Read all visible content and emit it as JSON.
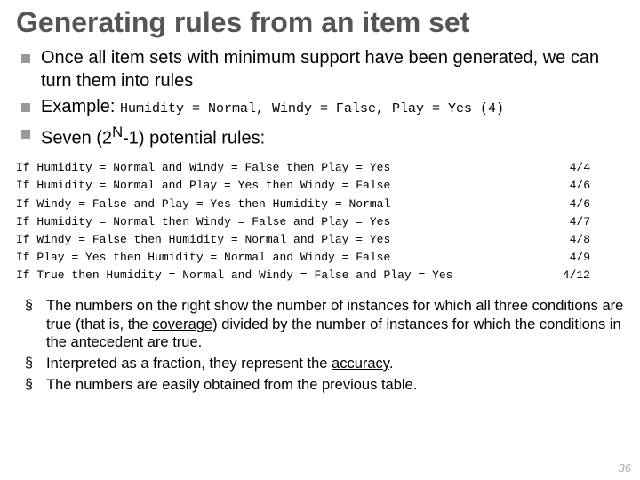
{
  "title": "Generating rules from an item set",
  "bullets": {
    "b1": "Once all item sets with minimum support have been generated, we can turn them into rules",
    "b2_prefix": "Example:",
    "b2_example": "Humidity = Normal, Windy = False, Play = Yes (4)",
    "b3_pre": "Seven (2",
    "b3_sup": "N",
    "b3_post": "-1) potential rules:"
  },
  "rules": [
    {
      "text": "If Humidity = Normal and Windy = False then Play = Yes",
      "ratio": "4/4"
    },
    {
      "text": "If Humidity = Normal and Play = Yes then Windy = False",
      "ratio": "4/6"
    },
    {
      "text": "If Windy = False and Play = Yes then Humidity = Normal",
      "ratio": "4/6"
    },
    {
      "text": "If Humidity = Normal then Windy = False and Play = Yes",
      "ratio": "4/7"
    },
    {
      "text": "If Windy = False then Humidity = Normal and Play = Yes",
      "ratio": "4/8"
    },
    {
      "text": "If Play = Yes then Humidity = Normal and Windy = False",
      "ratio": "4/9"
    },
    {
      "text": "If True then Humidity = Normal and Windy = False and Play = Yes",
      "ratio": "4/12"
    }
  ],
  "notes": {
    "n1_pre": "The numbers on the right show the number of instances for which all three conditions are true (that is, the ",
    "n1_kw": "coverage",
    "n1_post": ") divided by the number of instances for which the conditions in the antecedent are true.",
    "n2_pre": "Interpreted as a fraction, they represent the ",
    "n2_kw": "accuracy",
    "n2_post": ".",
    "n3": "The numbers are easily obtained from the previous table."
  },
  "page": "36"
}
